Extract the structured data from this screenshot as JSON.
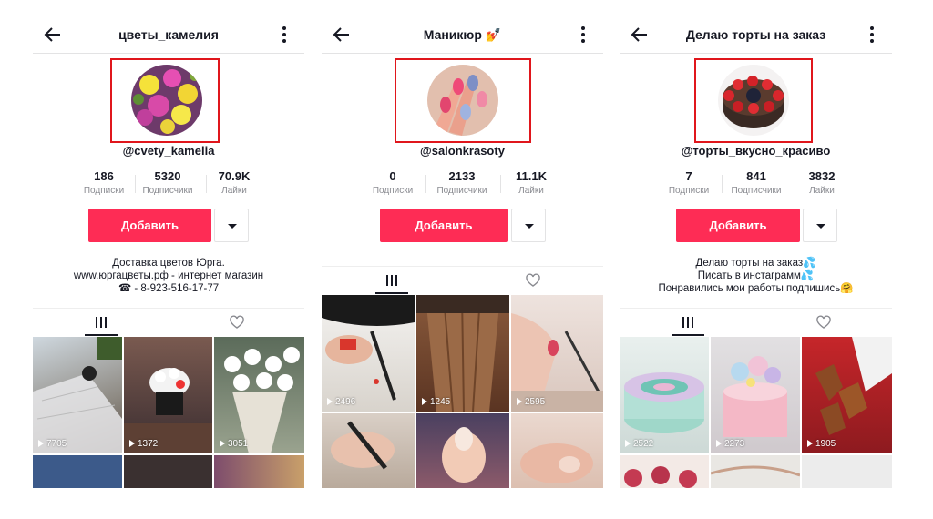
{
  "profiles": [
    {
      "title": "цветы_камелия",
      "handle": "@cvety_kamelia",
      "stats": [
        {
          "value": "186",
          "label": "Подписки"
        },
        {
          "value": "5320",
          "label": "Подписчики"
        },
        {
          "value": "70.9K",
          "label": "Лайки"
        }
      ],
      "add_label": "Добавить",
      "bio": [
        "Доставка цветов Юрга.",
        "www.юргацветы.рф - интернет магазин",
        "☎ - 8-923-516-17-77"
      ],
      "videos": [
        {
          "views": "7705"
        },
        {
          "views": "1372"
        },
        {
          "views": "3051"
        }
      ]
    },
    {
      "title": "Маникюр 💅",
      "handle": "@salonkrasoty",
      "stats": [
        {
          "value": "0",
          "label": "Подписки"
        },
        {
          "value": "2133",
          "label": "Подписчики"
        },
        {
          "value": "11.1K",
          "label": "Лайки"
        }
      ],
      "add_label": "Добавить",
      "bio": [],
      "videos": [
        {
          "views": "2496"
        },
        {
          "views": "1245"
        },
        {
          "views": "2595"
        }
      ]
    },
    {
      "title": "Делаю торты на заказ",
      "handle": "@торты_вкусно_красиво",
      "stats": [
        {
          "value": "7",
          "label": "Подписки"
        },
        {
          "value": "841",
          "label": "Подписчики"
        },
        {
          "value": "3832",
          "label": "Лайки"
        }
      ],
      "add_label": "Добавить",
      "bio": [
        "Делаю торты на заказ💦",
        "Писать в инстаграмм💦",
        "Понравились мои работы подпишись🤗"
      ],
      "videos": [
        {
          "views": "2522"
        },
        {
          "views": "2273"
        },
        {
          "views": "1905"
        }
      ]
    }
  ],
  "colors": {
    "accent": "#fe2c55",
    "highlight_box": "#e0161c"
  },
  "icons": [
    "back-arrow-icon",
    "more-vertical-icon",
    "videos-grid-icon",
    "liked-heart-icon",
    "play-icon"
  ]
}
